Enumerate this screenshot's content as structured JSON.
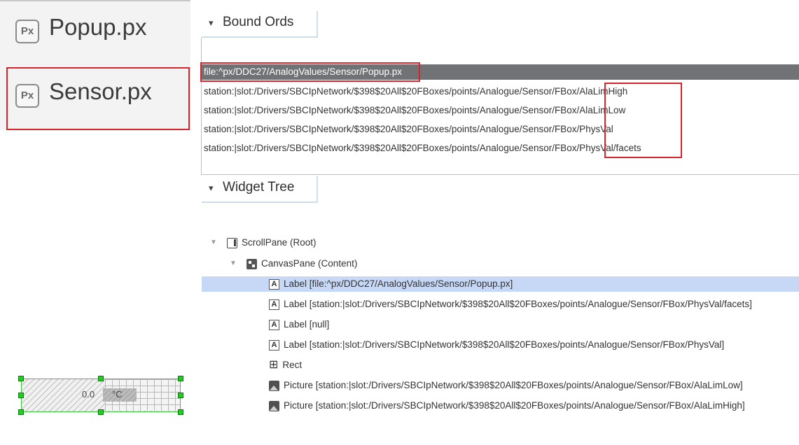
{
  "files": [
    {
      "icon": "Px",
      "name": "Popup.px"
    },
    {
      "icon": "Px",
      "name": "Sensor.px"
    }
  ],
  "bound_ords": {
    "title": "Bound Ords",
    "rows": [
      "file:^px/DDC27/AnalogValues/Sensor/Popup.px",
      "station:|slot:/Drivers/SBCIpNetwork/$398$20All$20FBoxes/points/Analogue/Sensor/FBox/AlaLimHigh",
      "station:|slot:/Drivers/SBCIpNetwork/$398$20All$20FBoxes/points/Analogue/Sensor/FBox/AlaLimLow",
      "station:|slot:/Drivers/SBCIpNetwork/$398$20All$20FBoxes/points/Analogue/Sensor/FBox/PhysVal",
      "station:|slot:/Drivers/SBCIpNetwork/$398$20All$20FBoxes/points/Analogue/Sensor/FBox/PhysVal/facets"
    ]
  },
  "widget_tree": {
    "title": "Widget Tree",
    "root": "ScrollPane (Root)",
    "content": "CanvasPane (Content)",
    "items": [
      {
        "icon": "label-icon",
        "text": "Label [file:^px/DDC27/AnalogValues/Sensor/Popup.px]"
      },
      {
        "icon": "label-icon",
        "text": "Label [station:|slot:/Drivers/SBCIpNetwork/$398$20All$20FBoxes/points/Analogue/Sensor/FBox/PhysVal/facets]"
      },
      {
        "icon": "label-icon",
        "text": "Label [null]"
      },
      {
        "icon": "label-icon",
        "text": "Label [station:|slot:/Drivers/SBCIpNetwork/$398$20All$20FBoxes/points/Analogue/Sensor/FBox/PhysVal]"
      },
      {
        "icon": "rect-icon",
        "text": "Rect"
      },
      {
        "icon": "picture-icon",
        "text": "Picture [station:|slot:/Drivers/SBCIpNetwork/$398$20All$20FBoxes/points/Analogue/Sensor/FBox/AlaLimLow]"
      },
      {
        "icon": "picture-icon",
        "text": "Picture [station:|slot:/Drivers/SBCIpNetwork/$398$20All$20FBoxes/points/Analogue/Sensor/FBox/AlaLimHigh]"
      }
    ]
  },
  "preview": {
    "value": "0.0",
    "unit": "°C"
  },
  "colors": {
    "highlight_red": "#d9252a",
    "selected_row": "#707275",
    "tree_selected": "#c6d8f5",
    "handle_green": "#22cc22"
  }
}
